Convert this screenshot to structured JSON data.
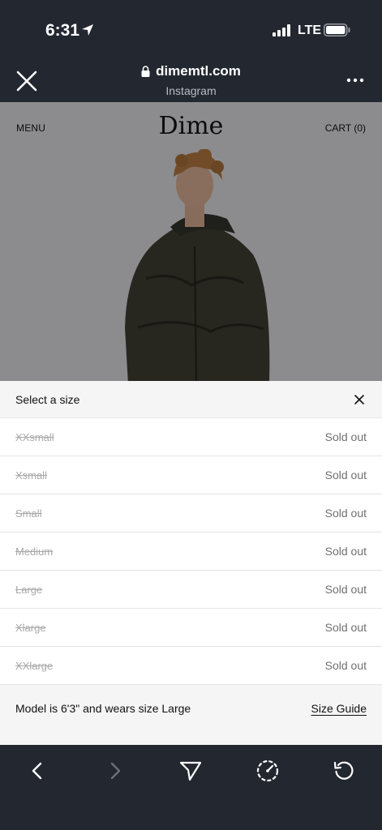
{
  "status_bar": {
    "time": "6:31",
    "network": "LTE"
  },
  "browser": {
    "url": "dimemtl.com",
    "subtitle": "Instagram"
  },
  "site": {
    "menu_label": "MENU",
    "logo": "Dime",
    "cart_label": "CART (0)"
  },
  "size_sheet": {
    "title": "Select a size",
    "sizes": [
      {
        "name": "XXsmall",
        "status": "Sold out"
      },
      {
        "name": "Xsmall",
        "status": "Sold out"
      },
      {
        "name": "Small",
        "status": "Sold out"
      },
      {
        "name": "Medium",
        "status": "Sold out"
      },
      {
        "name": "Large",
        "status": "Sold out"
      },
      {
        "name": "Xlarge",
        "status": "Sold out"
      },
      {
        "name": "XXlarge",
        "status": "Sold out"
      }
    ],
    "model_note": "Model is 6'3\" and wears size Large",
    "size_guide_label": "Size Guide"
  },
  "icons": {
    "status": [
      "location-arrow-icon",
      "signal-bars-icon",
      "battery-icon"
    ],
    "header": [
      "close-icon",
      "lock-icon",
      "more-dots-icon"
    ],
    "toolbar": [
      "back-arrow-icon",
      "forward-arrow-icon",
      "share-send-icon",
      "speedometer-icon",
      "reload-icon"
    ]
  },
  "colors": {
    "chrome_bg": "#222730",
    "sheet_bg": "#ffffff",
    "sheet_header_bg": "#f5f5f5",
    "sold_out_text": "#707070",
    "struck_size_text": "#a9a9a9"
  }
}
